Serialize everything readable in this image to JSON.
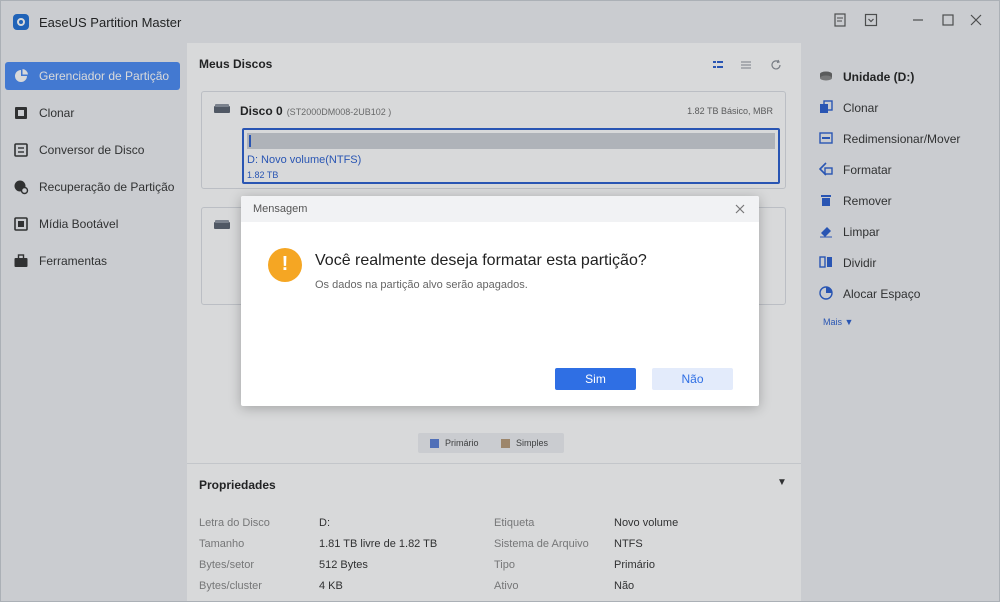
{
  "app": {
    "title": "EaseUS Partition Master"
  },
  "sidebar": {
    "items": [
      {
        "label": "Gerenciador de Partição",
        "icon": "pie-chart-icon",
        "active": true
      },
      {
        "label": "Clonar",
        "icon": "clone-icon"
      },
      {
        "label": "Conversor de Disco",
        "icon": "disk-convert-icon"
      },
      {
        "label": "Recuperação de Partição",
        "icon": "recovery-icon"
      },
      {
        "label": "Mídia Bootável",
        "icon": "bootable-media-icon"
      },
      {
        "label": "Ferramentas",
        "icon": "toolbox-icon"
      }
    ]
  },
  "main": {
    "title": "Meus Discos",
    "disks": [
      {
        "name": "Disco 0",
        "model": "(ST2000DM008-2UB102 )",
        "info": "1.82 TB Básico, MBR",
        "partition": {
          "name": "D: Novo volume(NTFS)",
          "size": "1.82 TB"
        }
      }
    ],
    "legend": [
      {
        "label": "Primário",
        "color": "#5b7fd6"
      },
      {
        "label": "Simples",
        "color": "#b89a78"
      }
    ]
  },
  "properties": {
    "title": "Propriedades",
    "left": [
      {
        "key": "Letra do Disco",
        "value": "D:"
      },
      {
        "key": "Tamanho",
        "value": "1.81 TB livre de 1.82 TB"
      },
      {
        "key": "Bytes/setor",
        "value": "512 Bytes"
      },
      {
        "key": "Bytes/cluster",
        "value": "4 KB"
      }
    ],
    "right": [
      {
        "key": "Etiqueta",
        "value": "Novo volume"
      },
      {
        "key": "Sistema de Arquivo",
        "value": "NTFS"
      },
      {
        "key": "Tipo",
        "value": "Primário"
      },
      {
        "key": "Ativo",
        "value": "Não"
      }
    ]
  },
  "actions": {
    "header": "Unidade (D:)",
    "items": [
      {
        "label": "Clonar",
        "icon": "clone-icon"
      },
      {
        "label": "Redimensionar/Mover",
        "icon": "resize-icon"
      },
      {
        "label": "Formatar",
        "icon": "format-icon"
      },
      {
        "label": "Remover",
        "icon": "trash-icon"
      },
      {
        "label": "Limpar",
        "icon": "eraser-icon"
      },
      {
        "label": "Dividir",
        "icon": "split-icon"
      },
      {
        "label": "Alocar Espaço",
        "icon": "allocate-icon"
      }
    ],
    "more": "Mais ▼"
  },
  "dialog": {
    "title": "Mensagem",
    "question": "Você realmente deseja formatar esta partição?",
    "detail": "Os dados na partição alvo serão apagados.",
    "yes": "Sim",
    "no": "Não"
  }
}
